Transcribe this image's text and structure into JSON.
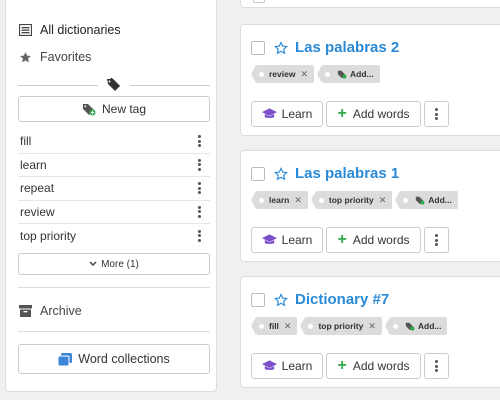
{
  "sidebar": {
    "nav": {
      "all_dictionaries": "All dictionaries",
      "favorites": "Favorites",
      "archive": "Archive"
    },
    "new_tag_label": "New tag",
    "tags": [
      "fill",
      "learn",
      "repeat",
      "review",
      "top priority"
    ],
    "more_label": "More (1)",
    "collections_label": "Word collections"
  },
  "cards": [
    {
      "title": "Las palabras 2",
      "tags": [
        "review"
      ],
      "add_tag_label": "Add..."
    },
    {
      "title": "Las palabras 1",
      "tags": [
        "learn",
        "top priority"
      ],
      "add_tag_label": "Add..."
    },
    {
      "title": "Dictionary #7",
      "tags": [
        "fill",
        "top priority"
      ],
      "add_tag_label": "Add..."
    }
  ],
  "actions": {
    "learn_label": "Learn",
    "add_words_label": "Add words"
  },
  "colors": {
    "title_blue": "#2b8ad6",
    "learn_purple": "#7b4fc9",
    "add_green": "#2eaa4a",
    "collections_blue": "#3f86d8"
  }
}
